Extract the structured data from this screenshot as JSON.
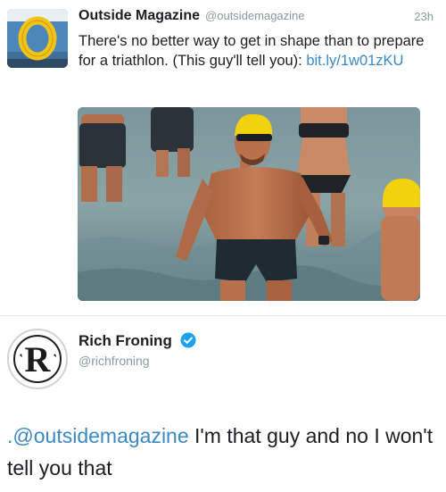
{
  "tweet1": {
    "display_name": "Outside Magazine",
    "handle": "@outsidemagazine",
    "time": "23h",
    "text_before_link": "There's no better way to get in shape than to prepare for a triathlon. (This guy'll tell you): ",
    "link": "bit.ly/1w01zKU",
    "avatar_letter": "O",
    "colors": {
      "link": "#3b88c3",
      "avatar_bg": "#4d87b9",
      "avatar_ring": "#f2c318"
    }
  },
  "tweet2": {
    "display_name": "Rich Froning",
    "handle": "@richfroning",
    "verified_icon": "verified-badge-icon",
    "avatar_letter": "R",
    "mention": ".@outsidemagazine",
    "text": " I'm that guy and no I won't tell you that",
    "colors": {
      "mention": "#3b88c3",
      "verified": "#1da1f2"
    }
  }
}
